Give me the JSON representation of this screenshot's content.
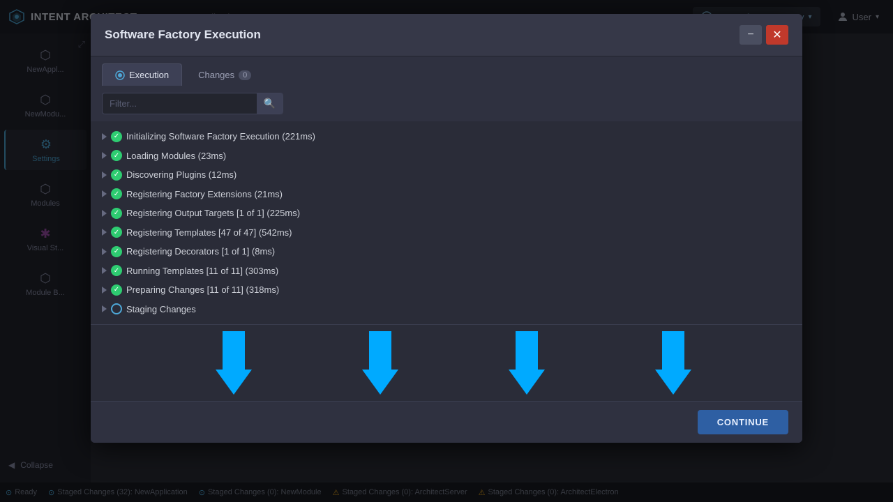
{
  "app": {
    "title": "INTENT ARCHITECT",
    "recent_apps_label": "Recent Applications",
    "run_factory_label": "Run Software Factory",
    "user_label": "User"
  },
  "sidebar": {
    "items": [
      {
        "id": "new-app",
        "label": "NewAppl...",
        "icon": "⬡"
      },
      {
        "id": "new-module",
        "label": "NewModu...",
        "icon": "⬡"
      },
      {
        "id": "settings",
        "label": "Settings",
        "icon": "⚙"
      },
      {
        "id": "modules",
        "label": "Modules",
        "icon": "⬡"
      },
      {
        "id": "visual-studio",
        "label": "Visual St...",
        "icon": "⬡"
      },
      {
        "id": "module-b",
        "label": "Module B...",
        "icon": "⬡"
      }
    ],
    "collapse_label": "Collapse"
  },
  "modal": {
    "title": "Software Factory Execution",
    "minimize_label": "−",
    "close_label": "✕",
    "tabs": [
      {
        "id": "execution",
        "label": "Execution",
        "active": true
      },
      {
        "id": "changes",
        "label": "Changes",
        "badge": "0"
      }
    ],
    "filter_placeholder": "Filter...",
    "log_items": [
      {
        "id": 1,
        "text": "Initializing Software Factory Execution (221ms)",
        "status": "check"
      },
      {
        "id": 2,
        "text": "Loading Modules (23ms)",
        "status": "check"
      },
      {
        "id": 3,
        "text": "Discovering Plugins (12ms)",
        "status": "check"
      },
      {
        "id": 4,
        "text": "Registering Factory Extensions (21ms)",
        "status": "check"
      },
      {
        "id": 5,
        "text": "Registering Output Targets [1 of 1] (225ms)",
        "status": "check"
      },
      {
        "id": 6,
        "text": "Registering Templates [47 of 47] (542ms)",
        "status": "check"
      },
      {
        "id": 7,
        "text": "Registering Decorators [1 of 1] (8ms)",
        "status": "check"
      },
      {
        "id": 8,
        "text": "Running Templates [11 of 11] (303ms)",
        "status": "check"
      },
      {
        "id": 9,
        "text": "Preparing Changes [11 of 11] (318ms)",
        "status": "check"
      },
      {
        "id": 10,
        "text": "Staging Changes",
        "status": "spinner"
      }
    ],
    "continue_label": "CONTINUE"
  },
  "status_bar": {
    "ready_label": "Ready",
    "items": [
      {
        "id": "staged-newapp",
        "text": "Staged Changes (32): NewApplication"
      },
      {
        "id": "staged-newmodule",
        "text": "Staged Changes (0): NewModule"
      },
      {
        "id": "staged-architect-server",
        "text": "Staged Changes (0): ArchitectServer"
      },
      {
        "id": "staged-architect-electron",
        "text": "Staged Changes (0): ArchitectElectron"
      }
    ]
  }
}
